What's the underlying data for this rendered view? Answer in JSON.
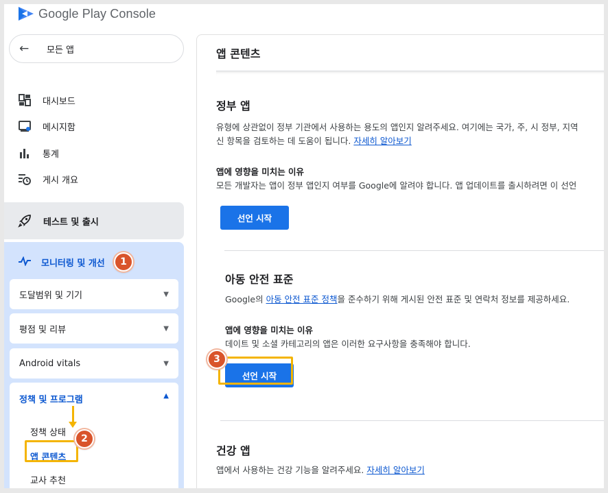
{
  "app": {
    "logo_text": "Google Play Console"
  },
  "sidebar": {
    "all_apps": {
      "label": "모든 앱",
      "icon": "arrow-back-icon"
    },
    "items": [
      {
        "label": "대시보드",
        "icon": "dashboard-icon"
      },
      {
        "label": "메시지함",
        "icon": "inbox-icon"
      },
      {
        "label": "통계",
        "icon": "bar-chart-icon"
      },
      {
        "label": "게시 개요",
        "icon": "publishing-overview-icon"
      }
    ],
    "testing": {
      "label": "테스트 및 출시",
      "icon": "rocket-icon"
    },
    "monitoring": {
      "label": "모니터링 및 개선",
      "icon": "pulse-icon"
    },
    "groups": [
      {
        "label": "도달범위 및 기기",
        "expanded": false
      },
      {
        "label": "평점 및 리뷰",
        "expanded": false
      },
      {
        "label": "Android vitals",
        "expanded": false
      },
      {
        "label": "정책 및 프로그램",
        "expanded": true
      }
    ],
    "sub_items": [
      {
        "label": "정책 상태",
        "active": false
      },
      {
        "label": "앱 콘텐츠",
        "active": true
      },
      {
        "label": "교사 추천",
        "active": false
      }
    ]
  },
  "main": {
    "page_title": "앱 콘텐츠",
    "sections": {
      "government": {
        "title": "정부 앱",
        "desc_line1": "유형에 상관없이 정부 기관에서 사용하는 용도의 앱인지 알려주세요. 여기에는 국가, 주, 시 정부, 지역",
        "desc_line2": "신 항목을 검토하는 데 도움이 됩니다.",
        "link": "자세히 알아보기",
        "impact_title": "앱에 영향을 미치는 이유",
        "impact_text": "모든 개발자는 앱이 정부 앱인지 여부를 Google에 알려야 합니다. 앱 업데이트를 출시하려면 이 선언",
        "button": "선언 시작"
      },
      "child_safety": {
        "title": "아동 안전 표준",
        "desc_prefix": "Google의 ",
        "desc_link": "아동 안전 표준 정책",
        "desc_suffix": "을 준수하기 위해 게시된 안전 표준 및 연락처 정보를 제공하세요.",
        "impact_title": "앱에 영향을 미치는 이유",
        "impact_text": "데이트 및 소셜 카테고리의 앱은 이러한 요구사항을 충족해야 합니다.",
        "button": "선언 시작"
      },
      "health": {
        "title": "건강 앱",
        "desc": "앱에서 사용하는 건강 기능을 알려주세요. ",
        "link": "자세히 알아보기"
      }
    }
  },
  "annotations": {
    "badge_1": "1",
    "badge_2": "2",
    "badge_3": "3",
    "highlight_color": "#f4b400",
    "badge_color": "#d9542b"
  },
  "colors": {
    "accent": "#0b57d0",
    "button": "#1a73e8",
    "active_bg": "#d3e3fd",
    "testing_bg": "#e8eaed"
  }
}
